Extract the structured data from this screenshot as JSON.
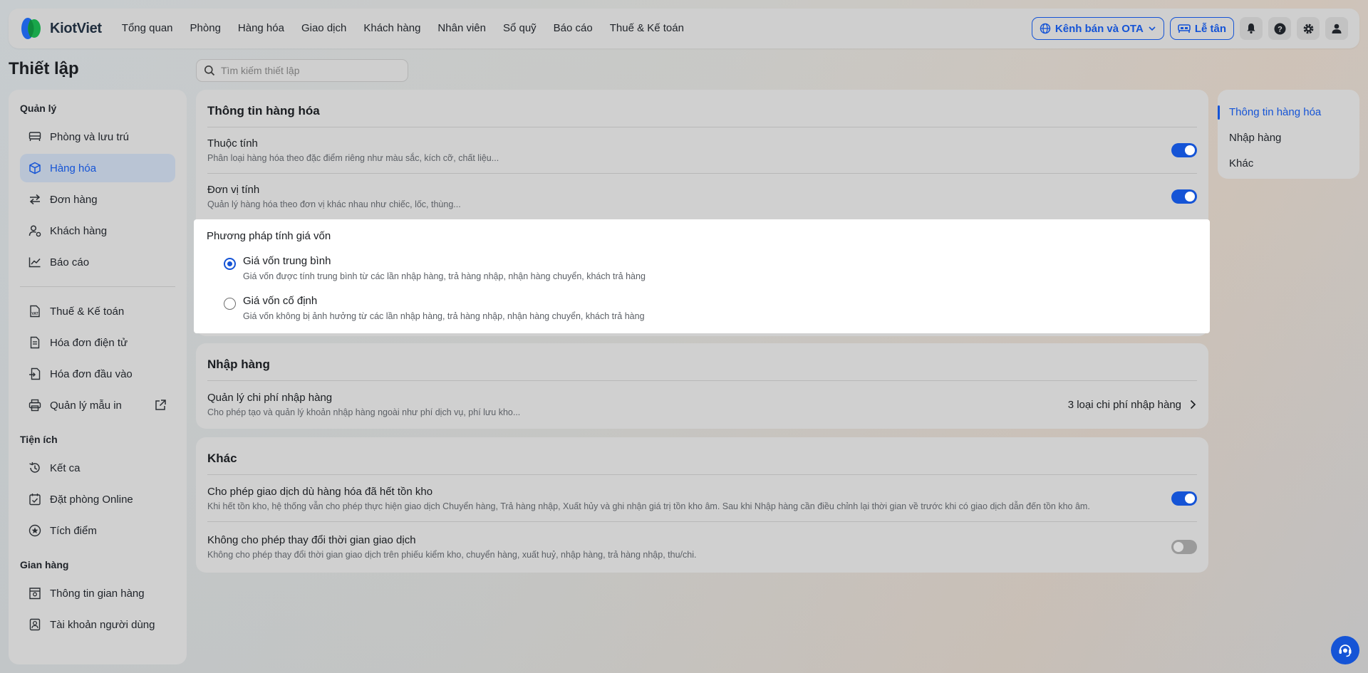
{
  "app": {
    "logo_text": "KiotViet",
    "nav": [
      "Tổng quan",
      "Phòng",
      "Hàng hóa",
      "Giao dịch",
      "Khách hàng",
      "Nhân viên",
      "Sổ quỹ",
      "Báo cáo",
      "Thuế & Kế toán"
    ],
    "channel_button": "Kênh bán và OTA",
    "reception_button": "Lễ tân"
  },
  "page": {
    "title": "Thiết lập",
    "search_placeholder": "Tìm kiếm thiết lập"
  },
  "sidebar": {
    "section_manage": "Quản lý",
    "manage_items": [
      "Phòng và lưu trú",
      "Hàng hóa",
      "Đơn hàng",
      "Khách hàng",
      "Báo cáo"
    ],
    "finance_items": [
      "Thuế & Kế toán",
      "Hóa đơn điện tử",
      "Hóa đơn đầu vào",
      "Quản lý mẫu in"
    ],
    "section_utility": "Tiện ích",
    "utility_items": [
      "Kết ca",
      "Đặt phòng Online",
      "Tích điểm"
    ],
    "section_store": "Gian hàng",
    "store_items": [
      "Thông tin gian hàng",
      "Tài khoản người dùng"
    ]
  },
  "goods_info": {
    "title": "Thông tin hàng hóa",
    "attributes": {
      "title": "Thuộc tính",
      "desc": "Phân loại hàng hóa theo đặc điểm riêng như màu sắc, kích cỡ, chất liệu...",
      "enabled": true
    },
    "units": {
      "title": "Đơn vị tính",
      "desc": "Quản lý hàng hóa theo đơn vị khác nhau như chiếc, lốc, thùng...",
      "enabled": true
    },
    "cost_method": {
      "title": "Phương pháp tính giá vốn",
      "options": [
        {
          "label": "Giá vốn trung bình",
          "desc": "Giá vốn được tính trung bình từ các lần nhập hàng, trả hàng nhập, nhận hàng chuyển, khách trả hàng",
          "selected": true
        },
        {
          "label": "Giá vốn cố định",
          "desc": "Giá vốn không bị ảnh hưởng từ các lần nhập hàng, trả hàng nhập, nhận hàng chuyển, khách trả hàng",
          "selected": false
        }
      ]
    }
  },
  "import": {
    "title": "Nhập hàng",
    "cost_mgmt": {
      "title": "Quản lý chi phí nhập hàng",
      "desc": "Cho phép tạo và quản lý khoản nhập hàng ngoài như phí dịch vụ, phí lưu kho...",
      "value": "3 loại chi phí nhập hàng"
    }
  },
  "other": {
    "title": "Khác",
    "allow_oos": {
      "title": "Cho phép giao dịch dù hàng hóa đã hết tồn kho",
      "desc": "Khi hết tồn kho, hệ thống vẫn cho phép thực hiện giao dịch Chuyển hàng, Trả hàng nhập, Xuất hủy và ghi nhận giá trị tồn kho âm. Sau khi Nhập hàng cần điều chỉnh lại thời gian về trước khi có giao dịch dẫn đến tồn kho âm.",
      "enabled": true
    },
    "lock_time": {
      "title": "Không cho phép thay đổi thời gian giao dịch",
      "desc": "Không cho phép thay đổi thời gian giao dịch trên phiếu kiểm kho, chuyển hàng, xuất huỷ, nhập hàng, trả hàng nhập, thu/chi.",
      "enabled": false
    }
  },
  "toc": [
    "Thông tin hàng hóa",
    "Nhập hàng",
    "Khác"
  ],
  "colors": {
    "accent": "#1554d6"
  }
}
